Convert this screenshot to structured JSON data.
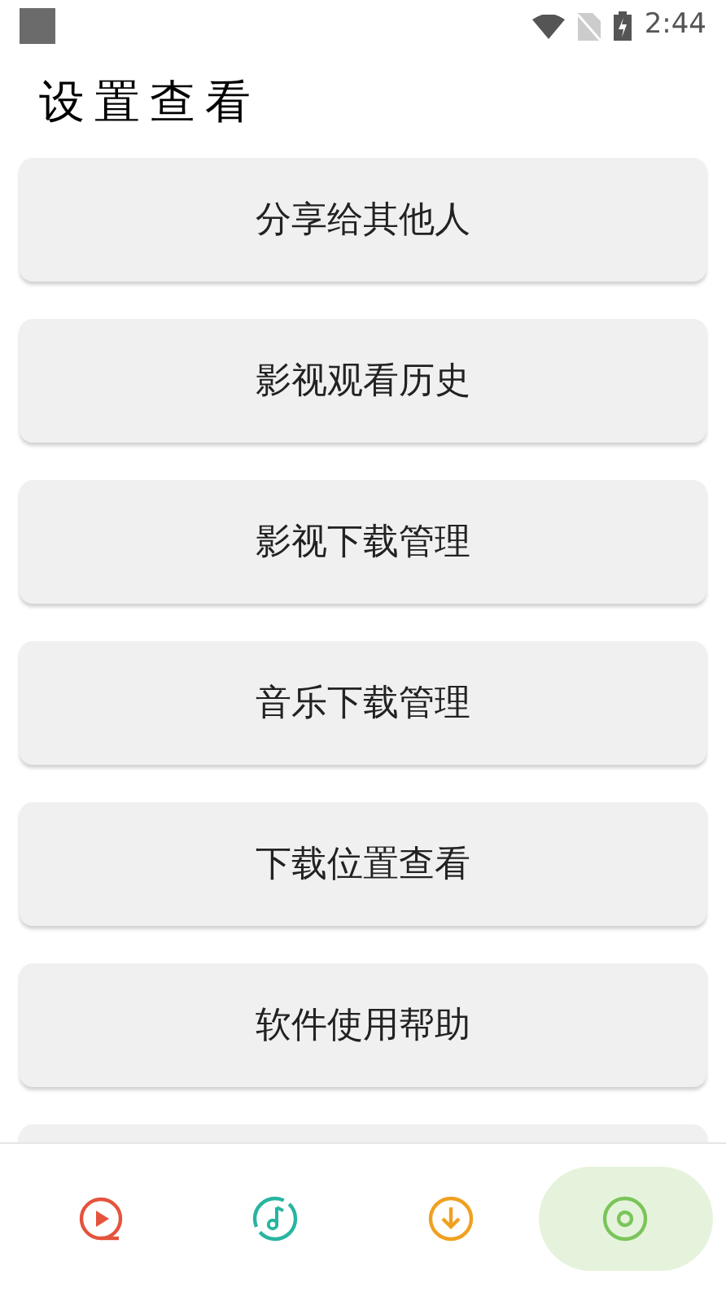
{
  "status_bar": {
    "time": "2:44"
  },
  "title": "设置查看",
  "menu": [
    {
      "label": "分享给其他人"
    },
    {
      "label": "影视观看历史"
    },
    {
      "label": "影视下载管理"
    },
    {
      "label": "音乐下载管理"
    },
    {
      "label": "下载位置查看"
    },
    {
      "label": "软件使用帮助"
    }
  ],
  "bottom_nav": [
    {
      "kind": "video",
      "selected": false
    },
    {
      "kind": "music",
      "selected": false
    },
    {
      "kind": "download",
      "selected": false
    },
    {
      "kind": "settings",
      "selected": true
    }
  ]
}
